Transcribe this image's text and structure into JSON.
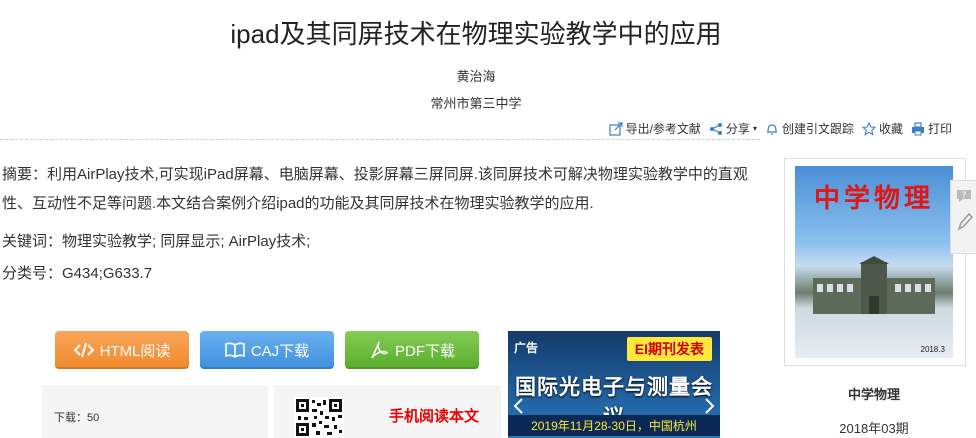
{
  "article": {
    "title": "ipad及其同屏技术在物理实验教学中的应用",
    "author": "黄治海",
    "organization": "常州市第三中学"
  },
  "toolbar": {
    "export": "导出/参考文献",
    "share": "分享",
    "cite_track": "创建引文跟踪",
    "favorite": "收藏",
    "print": "打印"
  },
  "abstract": {
    "text": "摘要：利用AirPlay技术,可实现iPad屏幕、电脑屏幕、投影屏幕三屏同屏.该同屏技术可解决物理实验教学中的直观性、互动性不足等问题.本文结合案例介绍ipad的功能及其同屏技术在物理实验教学的应用.",
    "keywords": "关键词：物理实验教学; 同屏显示; AirPlay技术;",
    "classification": "分类号：G434;G633.7"
  },
  "buttons": {
    "html_read": "HTML阅读",
    "caj_download": "CAJ下载",
    "pdf_download": "PDF下载"
  },
  "downloads": {
    "label": "下载：50"
  },
  "mobile": {
    "label": "手机阅读本文"
  },
  "ad": {
    "tag": "广告",
    "headline": "EI期刊发表",
    "title": "国际光电子与测量会议",
    "date": "2019年11月28-30日，中国杭州"
  },
  "journal": {
    "cover_title": "中学物理",
    "cover_issue": "2018.3",
    "name": "中学物理",
    "issue": "2018年03期"
  },
  "colors": {
    "html_button": "#f08a2c",
    "caj_button": "#3f8fdd",
    "pdf_button": "#5aad2e",
    "toolbar_icon": "#3b7fc4"
  }
}
